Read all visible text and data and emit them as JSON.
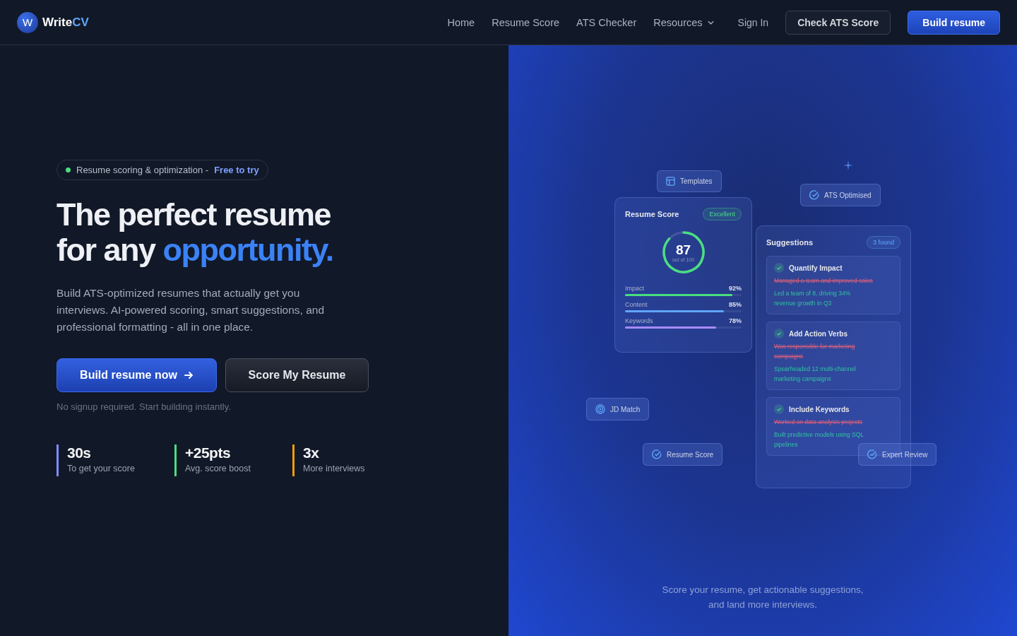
{
  "nav": {
    "brand": {
      "mark": "W",
      "name": "Write",
      "accent": "CV"
    },
    "links": [
      {
        "label": "Home",
        "dropdown": false
      },
      {
        "label": "Resume Score",
        "dropdown": false
      },
      {
        "label": "ATS Checker",
        "dropdown": false
      },
      {
        "label": "Resources",
        "dropdown": true
      }
    ],
    "sign_in": "Sign In",
    "secondary_button": "Check ATS Score",
    "primary_button": "Build resume"
  },
  "hero": {
    "badge": {
      "text": "Resume scoring & optimization -",
      "highlight": "Free to try"
    },
    "headline": [
      "The perfect resume",
      "for any"
    ],
    "headline_accent": "opportunity.",
    "subtitle": "Build ATS-optimized resumes that actually get you interviews. AI-powered scoring, smart suggestions, and professional formatting - all in one place.",
    "primary_cta": "Build resume now",
    "secondary_cta": "Score My Resume",
    "note": "No signup required. Start building instantly.",
    "stats": [
      {
        "value": "30s",
        "label": "To get your score",
        "color": "#818cf8"
      },
      {
        "value": "+25pts",
        "label": "Avg. score boost",
        "color": "#4ade80"
      },
      {
        "value": "3x",
        "label": "More interviews",
        "color": "#f59e0b"
      }
    ]
  },
  "preview": {
    "score_card": {
      "title": "Resume Score",
      "badge": "Excellent",
      "score": "87",
      "score_caption": "out of 100",
      "level": 0.87,
      "metrics": [
        {
          "name": "Impact",
          "reading": "92%",
          "level": 0.92,
          "color": "#4ade80"
        },
        {
          "name": "Content",
          "reading": "85%",
          "level": 0.85,
          "color": "#60a5fa"
        },
        {
          "name": "Keywords",
          "reading": "78%",
          "level": 0.78,
          "color": "#a78bfa"
        }
      ]
    },
    "suggestions": {
      "title": "Suggestions",
      "count": "3 found",
      "items": [
        {
          "title": "Quantify Impact",
          "before": "Managed a team and improved sales",
          "after": "Led a team of 8, driving 34% revenue growth in Q3"
        },
        {
          "title": "Add Action Verbs",
          "before": "Was responsible for marketing campaigns",
          "after": "Spearheaded 12 multi-channel marketing campaigns"
        },
        {
          "title": "Include Keywords",
          "before": "Worked on data analysis projects",
          "after": "Built predictive models using SQL pipelines"
        }
      ]
    },
    "chips": [
      {
        "label": "Templates",
        "kind": "layout"
      },
      {
        "label": "ATS Optimised",
        "kind": "check"
      },
      {
        "label": "JD Match",
        "kind": "target"
      },
      {
        "label": "Resume Score",
        "kind": "check"
      },
      {
        "label": "Expert Review",
        "kind": "check"
      }
    ],
    "caption": [
      "Score your resume, get actionable suggestions,",
      "and land more interviews."
    ]
  }
}
